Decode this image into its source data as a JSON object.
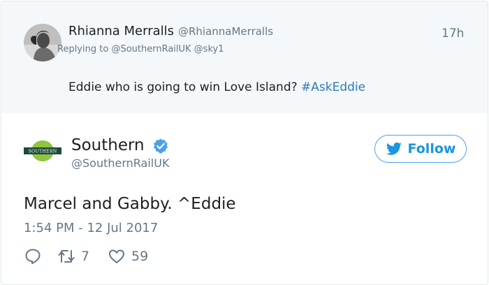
{
  "reply_tweet": {
    "author_name": "Rhianna Merralls",
    "author_handle": "@RhiannaMerralls",
    "time": "17h",
    "replying_prefix": "Replying to ",
    "replying_mentions": "@SouthernRailUK @sky1",
    "text": "Eddie who is going to win Love Island? ",
    "hashtag": "#AskEddie"
  },
  "main_tweet": {
    "author_name": "Southern",
    "author_handle": "@SouthernRailUK",
    "logo_text": "SOUTHERN",
    "verified": true,
    "follow_label": "Follow",
    "text": "Marcel and Gabby. ^Eddie",
    "timestamp": "1:54 PM - 12 Jul 2017",
    "actions": {
      "reply_icon": "reply-icon",
      "retweet_count": "7",
      "like_count": "59"
    }
  },
  "colors": {
    "link_blue": "#2b7bb9",
    "follow_blue": "#1b95e0",
    "muted": "#657786",
    "reply_bg": "#f5f8fa",
    "southern_green": "#8dc63f",
    "southern_dark": "#1e4a3a"
  }
}
